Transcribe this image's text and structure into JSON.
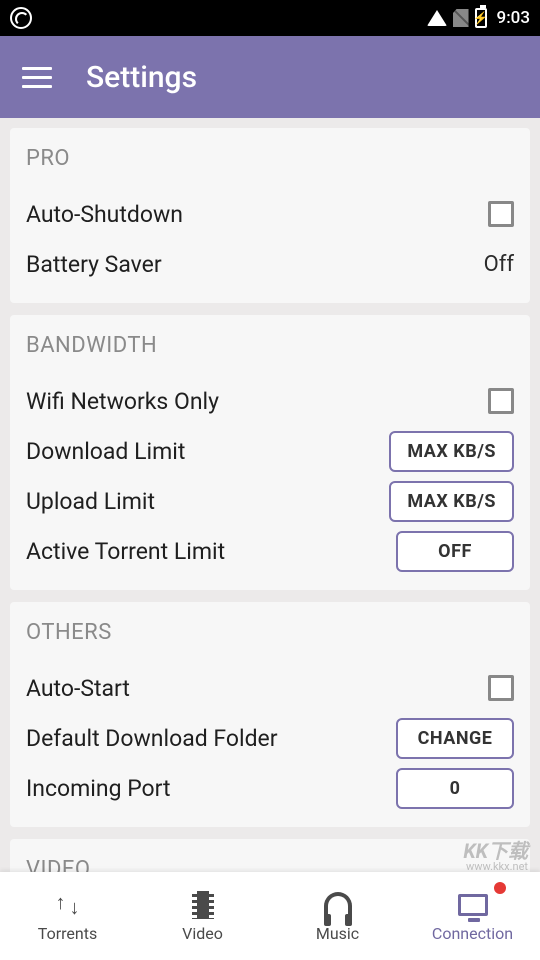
{
  "status_bar": {
    "time": "9:03"
  },
  "app_bar": {
    "title": "Settings"
  },
  "sections": {
    "pro": {
      "header": "PRO",
      "auto_shutdown": "Auto-Shutdown",
      "battery_saver": "Battery Saver",
      "battery_saver_value": "Off"
    },
    "bandwidth": {
      "header": "BANDWIDTH",
      "wifi_only": "Wifi Networks Only",
      "download_limit": "Download Limit",
      "download_limit_btn": "MAX KB/S",
      "upload_limit": "Upload Limit",
      "upload_limit_btn": "MAX KB/S",
      "active_torrent_limit": "Active Torrent Limit",
      "active_torrent_limit_btn": "OFF"
    },
    "others": {
      "header": "OTHERS",
      "auto_start": "Auto-Start",
      "default_folder": "Default Download Folder",
      "default_folder_btn": "CHANGE",
      "incoming_port": "Incoming Port",
      "incoming_port_btn": "0"
    },
    "video": {
      "header": "VIDEO"
    }
  },
  "nav": {
    "torrents": "Torrents",
    "video": "Video",
    "music": "Music",
    "connection": "Connection"
  },
  "watermark": {
    "brand": "KK下载",
    "url": "www.kkx.net"
  }
}
